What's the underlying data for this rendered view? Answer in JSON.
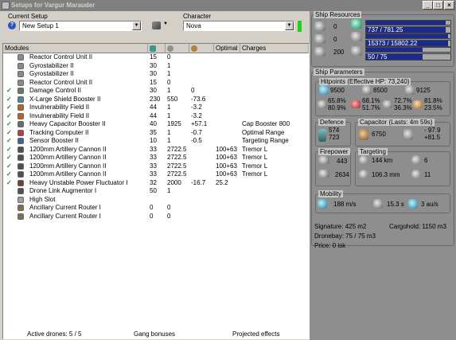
{
  "window": {
    "title": "Setups for Vargur Marauder",
    "min": "_",
    "max": "□",
    "close": "×"
  },
  "setup": {
    "label": "Current Setup",
    "value": "New Setup 1"
  },
  "character": {
    "label": "Character",
    "value": "Nova"
  },
  "grid": {
    "headers": [
      "Modules",
      "",
      "",
      "",
      "Optimal",
      "Charges"
    ],
    "rows": [
      {
        "check": "",
        "name": "Reactor Control Unit II",
        "c1": "15",
        "c2": "0",
        "c3": "",
        "opt": "",
        "ch": "",
        "color": "#8a8a8a"
      },
      {
        "check": "",
        "name": "Gyrostabilizer II",
        "c1": "30",
        "c2": "1",
        "c3": "",
        "opt": "",
        "ch": "",
        "color": "#8a8a8a"
      },
      {
        "check": "",
        "name": "Gyrostabilizer II",
        "c1": "30",
        "c2": "1",
        "c3": "",
        "opt": "",
        "ch": "",
        "color": "#8a8a8a"
      },
      {
        "check": "",
        "name": "Reactor Control Unit II",
        "c1": "15",
        "c2": "0",
        "c3": "",
        "opt": "",
        "ch": "",
        "color": "#8a8a8a"
      },
      {
        "check": "✓",
        "name": "Damage Control II",
        "c1": "30",
        "c2": "1",
        "c3": "0",
        "opt": "",
        "ch": "",
        "color": "#6a7a5a"
      },
      {
        "check": "✓",
        "name": "X-Large Shield Booster II",
        "c1": "230",
        "c2": "550",
        "c3": "-73.6",
        "opt": "",
        "ch": "",
        "color": "#4a8a9a"
      },
      {
        "check": "✓",
        "name": "Invulnerability Field II",
        "c1": "44",
        "c2": "1",
        "c3": "-3.2",
        "opt": "",
        "ch": "",
        "color": "#c06020"
      },
      {
        "check": "✓",
        "name": "Invulnerability Field II",
        "c1": "44",
        "c2": "1",
        "c3": "-3.2",
        "opt": "",
        "ch": "",
        "color": "#c06020"
      },
      {
        "check": "✓",
        "name": "Heavy Capacitor Booster II",
        "c1": "40",
        "c2": "1925",
        "c3": "+57.1",
        "opt": "",
        "ch": "Cap Booster 800",
        "color": "#6a6a6a"
      },
      {
        "check": "✓",
        "name": "Tracking Computer II",
        "c1": "35",
        "c2": "1",
        "c3": "-0.7",
        "opt": "",
        "ch": "Optimal Range",
        "color": "#b04040"
      },
      {
        "check": "✓",
        "name": "Sensor Booster II",
        "c1": "10",
        "c2": "1",
        "c3": "-0.5",
        "opt": "",
        "ch": "Targeting Range",
        "color": "#4060a0"
      },
      {
        "check": "✓",
        "name": "1200mm Artillery Cannon II",
        "c1": "33",
        "c2": "2722.5",
        "c3": "",
        "opt": "100+63",
        "ch": "Tremor L",
        "color": "#505050"
      },
      {
        "check": "✓",
        "name": "1200mm Artillery Cannon II",
        "c1": "33",
        "c2": "2722.5",
        "c3": "",
        "opt": "100+63",
        "ch": "Tremor L",
        "color": "#505050"
      },
      {
        "check": "✓",
        "name": "1200mm Artillery Cannon II",
        "c1": "33",
        "c2": "2722.5",
        "c3": "",
        "opt": "100+63",
        "ch": "Tremor L",
        "color": "#505050"
      },
      {
        "check": "✓",
        "name": "1200mm Artillery Cannon II",
        "c1": "33",
        "c2": "2722.5",
        "c3": "",
        "opt": "100+63",
        "ch": "Tremor L",
        "color": "#505050"
      },
      {
        "check": "✓",
        "name": "Heavy Unstable Power Fluctuator I",
        "c1": "32",
        "c2": "2000",
        "c3": "-16.7",
        "opt": "25.2",
        "ch": "",
        "color": "#704030"
      },
      {
        "check": "",
        "name": "Drone Link Augmentor I",
        "c1": "50",
        "c2": "1",
        "c3": "",
        "opt": "",
        "ch": "",
        "color": "#505050"
      },
      {
        "check": "",
        "name": "High Slot",
        "c1": "",
        "c2": "",
        "c3": "",
        "opt": "",
        "ch": "",
        "color": "#a0a0a0"
      },
      {
        "check": "",
        "name": "Ancillary Current Router I",
        "c1": "0",
        "c2": "0",
        "c3": "",
        "opt": "",
        "ch": "",
        "color": "#807050"
      },
      {
        "check": "",
        "name": "Ancillary Current Router I",
        "c1": "0",
        "c2": "0",
        "c3": "",
        "opt": "",
        "ch": "",
        "color": "#807050"
      }
    ]
  },
  "status": {
    "drones": "Active drones: 5 / 5",
    "gang": "Gang bonuses",
    "projected": "Projected effects"
  },
  "resources": {
    "title": "Ship Resources",
    "left": [
      "0",
      "0",
      "200"
    ],
    "bars": [
      {
        "text": "737 / 781.25",
        "pct": 94
      },
      {
        "text": "15373 / 15802.22",
        "pct": 97
      },
      {
        "text": "50 / 75",
        "pct": 67
      }
    ]
  },
  "params": {
    "title": "Ship Parameters",
    "hp_title": "Hitpoints (Effective HP: 73,240)",
    "hp": [
      "9500",
      "8500",
      "9125"
    ],
    "resists": [
      {
        "a": "65.8%",
        "b": "80.9%"
      },
      {
        "a": "68.1%",
        "b": "51.7%"
      },
      {
        "a": "72.7%",
        "b": "36.3%"
      },
      {
        "a": "81.8%",
        "b": "23.5%"
      }
    ],
    "defence": {
      "title": "Defence",
      "a": "574",
      "b": "723"
    },
    "capacitor": {
      "title": "Capacitor (Lasts: 4m 59s)",
      "val": "6750",
      "a": "- 97.9",
      "b": "+81.5"
    },
    "firepower": {
      "title": "Firepower",
      "a": "443",
      "b": "2634"
    },
    "targeting": {
      "title": "Targeting",
      "range": "144 km",
      "targets": "6",
      "sig": "106.3 mm",
      "scan": "11"
    },
    "mobility": {
      "title": "Mobility",
      "speed": "188 m/s",
      "align": "15.3 s",
      "warp": "3 au/s"
    },
    "signature": "Signature: 425 m2",
    "cargohold": "Cargohold: 1150 m3",
    "dronebay": "Dronebay: 75 / 75 m3",
    "price": "Price: 0 isk"
  }
}
